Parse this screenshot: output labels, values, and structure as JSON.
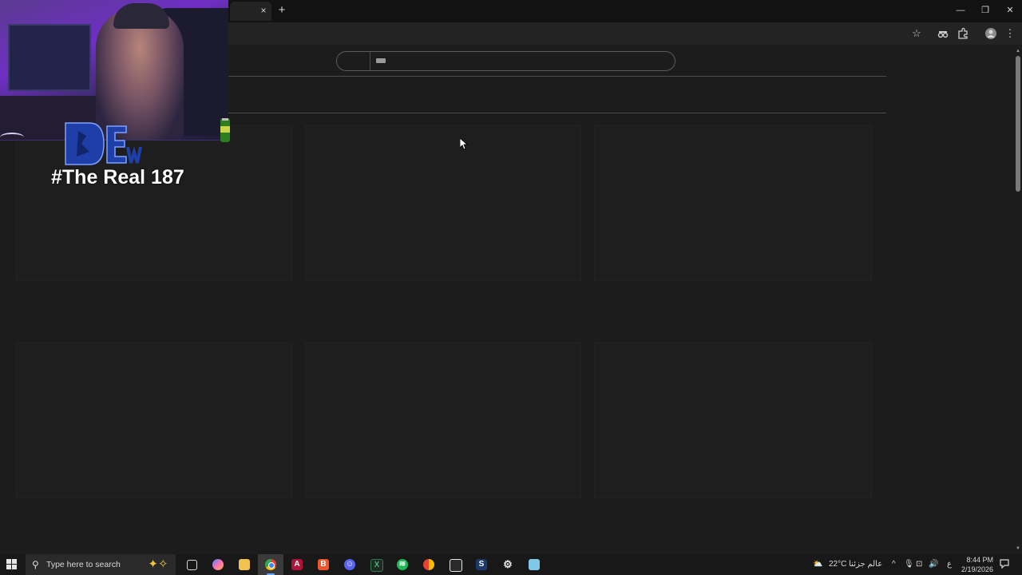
{
  "browser": {
    "tab_close_glyph": "×",
    "new_tab_glyph": "+",
    "window_controls": {
      "minimize": "—",
      "restore": "❐",
      "close": "✕"
    }
  },
  "toolbar": {
    "icons": [
      "star-icon",
      "incognito-icon",
      "extensions-icon",
      "profile-icon",
      "more-icon"
    ]
  },
  "overlay": {
    "caption": "#The Real 187"
  },
  "taskbar": {
    "search_placeholder": "Type here to search",
    "apps": [
      "task-view",
      "copilot",
      "file-explorer",
      "chrome",
      "acrobat",
      "brave",
      "discord",
      "excel",
      "spotify",
      "chrome-alt",
      "capcut",
      "steam",
      "settings",
      "notepad"
    ],
    "active_app": "chrome",
    "weather": "22°C  عالم جزئنا",
    "input_lang": "ع",
    "time": "8:44 PM",
    "date": "2/19/2026"
  },
  "colors": {
    "page_bg": "#1c1c1d",
    "tabstrip_bg": "#121212",
    "toolbar_bg": "#232324",
    "taskbar_bg": "#181818",
    "accent": "#6aa2ff"
  }
}
